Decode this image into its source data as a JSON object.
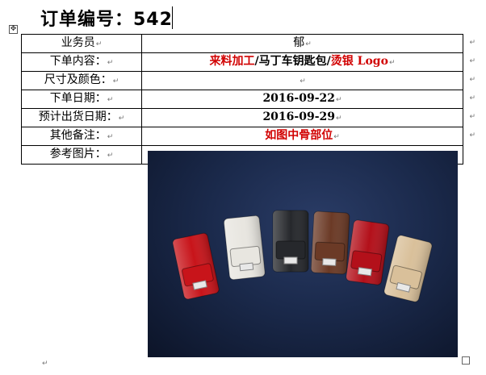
{
  "title": "订单编号：542",
  "rows": [
    {
      "label": "业务员",
      "value": "郁"
    },
    {
      "label": "下单内容：",
      "value_parts": [
        "来料加工",
        "/马丁车钥匙包/",
        "烫银 Logo"
      ]
    },
    {
      "label": "尺寸及颜色：",
      "value": ""
    },
    {
      "label": "下单日期：",
      "value": "2016-09-22"
    },
    {
      "label": "预计出货日期：",
      "value": "2016-09-29"
    },
    {
      "label": "其他备注：",
      "value": "如图中骨部位"
    },
    {
      "label": "参考图片：",
      "value": ""
    }
  ],
  "photo": {
    "description_icon": "leather-key-case-photo",
    "case_colors": [
      "#c8141a",
      "#e8e6e0",
      "#26282c",
      "#6b3a26",
      "#b3101a",
      "#d9c09a"
    ],
    "background_color": "#1b2a4c"
  },
  "marks": {
    "return": "↵"
  }
}
